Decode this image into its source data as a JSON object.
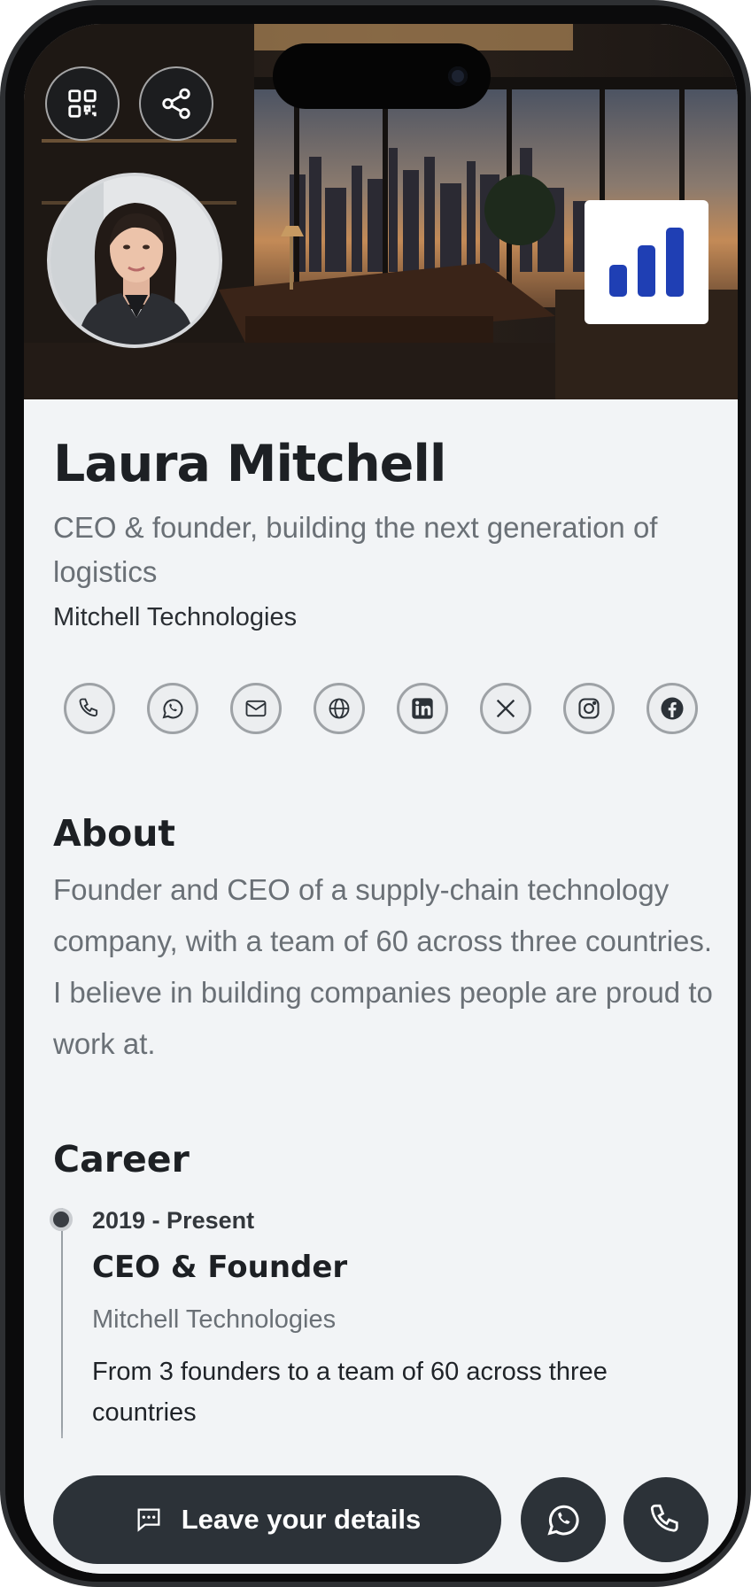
{
  "profile": {
    "name": "Laura Mitchell",
    "subtitle": "CEO & founder, building the next generation of logistics",
    "company": "Mitchell Technologies"
  },
  "header": {
    "qr_icon": "qr-code-icon",
    "share_icon": "share-icon",
    "brand_logo": "bar-chart-logo",
    "brand_color": "#1f3fb4"
  },
  "socials": [
    {
      "icon": "phone-icon"
    },
    {
      "icon": "whatsapp-icon"
    },
    {
      "icon": "email-icon"
    },
    {
      "icon": "globe-icon"
    },
    {
      "icon": "linkedin-icon"
    },
    {
      "icon": "x-icon"
    },
    {
      "icon": "instagram-icon"
    },
    {
      "icon": "facebook-icon"
    }
  ],
  "about": {
    "heading": "About",
    "text": "Founder and CEO of a supply-chain technology company, with a team of 60 across three countries. I believe in building companies people are proud to work at."
  },
  "career": {
    "heading": "Career",
    "items": [
      {
        "date": "2019 - Present",
        "title": "CEO & Founder",
        "company": "Mitchell Technologies",
        "description": "From 3 founders to a team of 60 across three countries"
      }
    ]
  },
  "actions": {
    "leave_details_label": "Leave your details",
    "whatsapp_icon": "whatsapp-icon",
    "call_icon": "phone-icon"
  },
  "colors": {
    "background": "#f2f4f6",
    "dark_button": "#2c3238",
    "text_primary": "#1d2024",
    "text_muted": "#6a7076"
  }
}
